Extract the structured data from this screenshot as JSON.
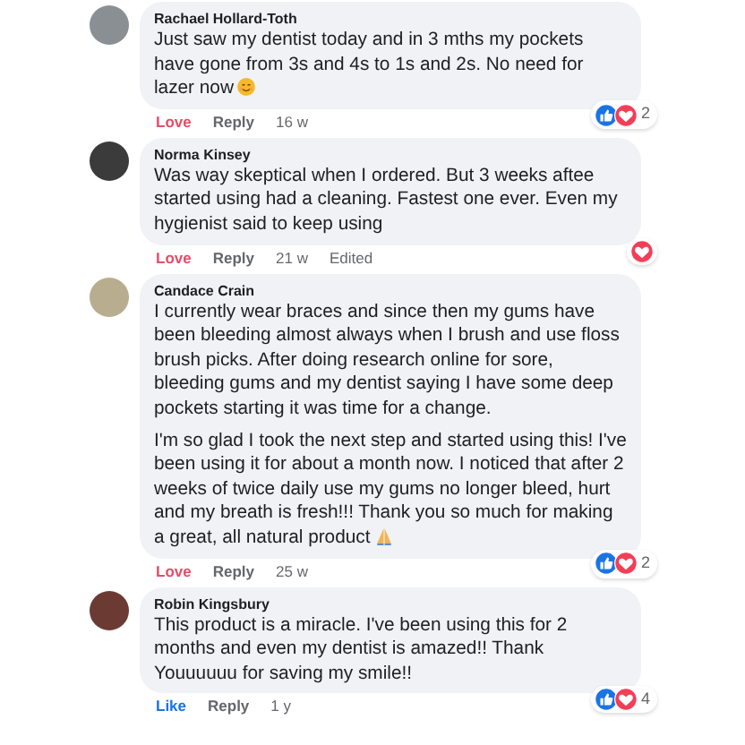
{
  "comments": [
    {
      "author": "Rachael Hollard-Toth",
      "paragraphs": [
        "Just saw my dentist today and in 3 mths my pockets have gone from 3s and 4s to 1s and 2s. No need for lazer now"
      ],
      "emoji": {
        "kind": "smile"
      },
      "reactions": {
        "icons": [
          {
            "kind": "like"
          },
          {
            "kind": "love"
          }
        ],
        "count": "2"
      },
      "actions": [
        {
          "label": "Love",
          "kind": "love"
        },
        {
          "label": "Reply",
          "kind": "reply"
        },
        {
          "label": "16 w",
          "kind": "time"
        }
      ]
    },
    {
      "author": "Norma Kinsey",
      "paragraphs": [
        "Was way skeptical when I ordered. But 3 weeks aftee started using had a cleaning. Fastest one ever. Even my hygienist said to keep using"
      ],
      "reactions": {
        "icons": [
          {
            "kind": "love"
          }
        ]
      },
      "actions": [
        {
          "label": "Love",
          "kind": "love"
        },
        {
          "label": "Reply",
          "kind": "reply"
        },
        {
          "label": "21 w",
          "kind": "time"
        },
        {
          "label": "Edited",
          "kind": "time"
        }
      ]
    },
    {
      "author": "Candace Crain",
      "paragraphs": [
        "I currently wear braces and since then my gums have been bleeding almost always when I brush and use floss brush picks. After doing research online for sore, bleeding gums and my dentist saying I have some deep pockets starting it was time for a change.",
        "I'm so glad I took the next step and started using this! I've been using it for about a month now. I noticed that after 2 weeks of twice daily use my gums no longer bleed, hurt and my breath is fresh!!! Thank you so much for making a great, all natural product"
      ],
      "emoji": {
        "kind": "pray"
      },
      "reactions": {
        "icons": [
          {
            "kind": "like"
          },
          {
            "kind": "love"
          }
        ],
        "count": "2"
      },
      "actions": [
        {
          "label": "Love",
          "kind": "love"
        },
        {
          "label": "Reply",
          "kind": "reply"
        },
        {
          "label": "25 w",
          "kind": "time"
        }
      ]
    },
    {
      "author": "Robin Kingsbury",
      "paragraphs": [
        "This product is a miracle. I've been using this for 2 months and even my dentist is amazed!! Thank Youuuuuu for saving my smile!!"
      ],
      "reactions": {
        "icons": [
          {
            "kind": "like"
          },
          {
            "kind": "love"
          }
        ],
        "count": "4"
      },
      "actions": [
        {
          "label": "Like",
          "kind": "like"
        },
        {
          "label": "Reply",
          "kind": "reply"
        },
        {
          "label": "1 y",
          "kind": "time"
        }
      ]
    }
  ]
}
